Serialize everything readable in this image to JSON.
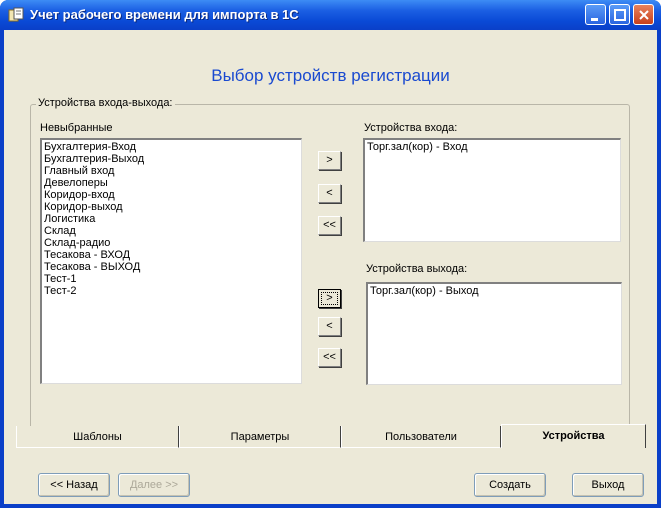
{
  "window": {
    "title": "Учет рабочего времени для импорта в 1С"
  },
  "heading": "Выбор устройств регистрации",
  "group": {
    "legend": "Устройства входа-выхода:",
    "unselected_label": "Невыбранные",
    "unselected_items": [
      "Бухгалтерия-Вход",
      "Бухгалтерия-Выход",
      "Главный вход",
      "Девелоперы",
      "Коридор-вход",
      "Коридор-выход",
      "Логистика",
      "Склад",
      "Склад-радио",
      "Тесакова - ВХОД",
      "Тесакова - ВЫХОД",
      "Тест-1",
      "Тест-2"
    ],
    "input_label": "Устройства входа:",
    "input_items": [
      "Торг.зал(кор) - Вход"
    ],
    "output_label": "Устройства выхода:",
    "output_items": [
      "Торг.зал(кор) - Выход"
    ],
    "buttons": {
      "add": ">",
      "remove": "<",
      "remove_all": "<<"
    }
  },
  "tabs": [
    {
      "label": "Шаблоны",
      "active": false
    },
    {
      "label": "Параметры",
      "active": false
    },
    {
      "label": "Пользователи",
      "active": false
    },
    {
      "label": "Устройства",
      "active": true
    }
  ],
  "footer": {
    "back": "<< Назад",
    "next": "Далее >>",
    "create": "Создать",
    "exit": "Выход"
  }
}
